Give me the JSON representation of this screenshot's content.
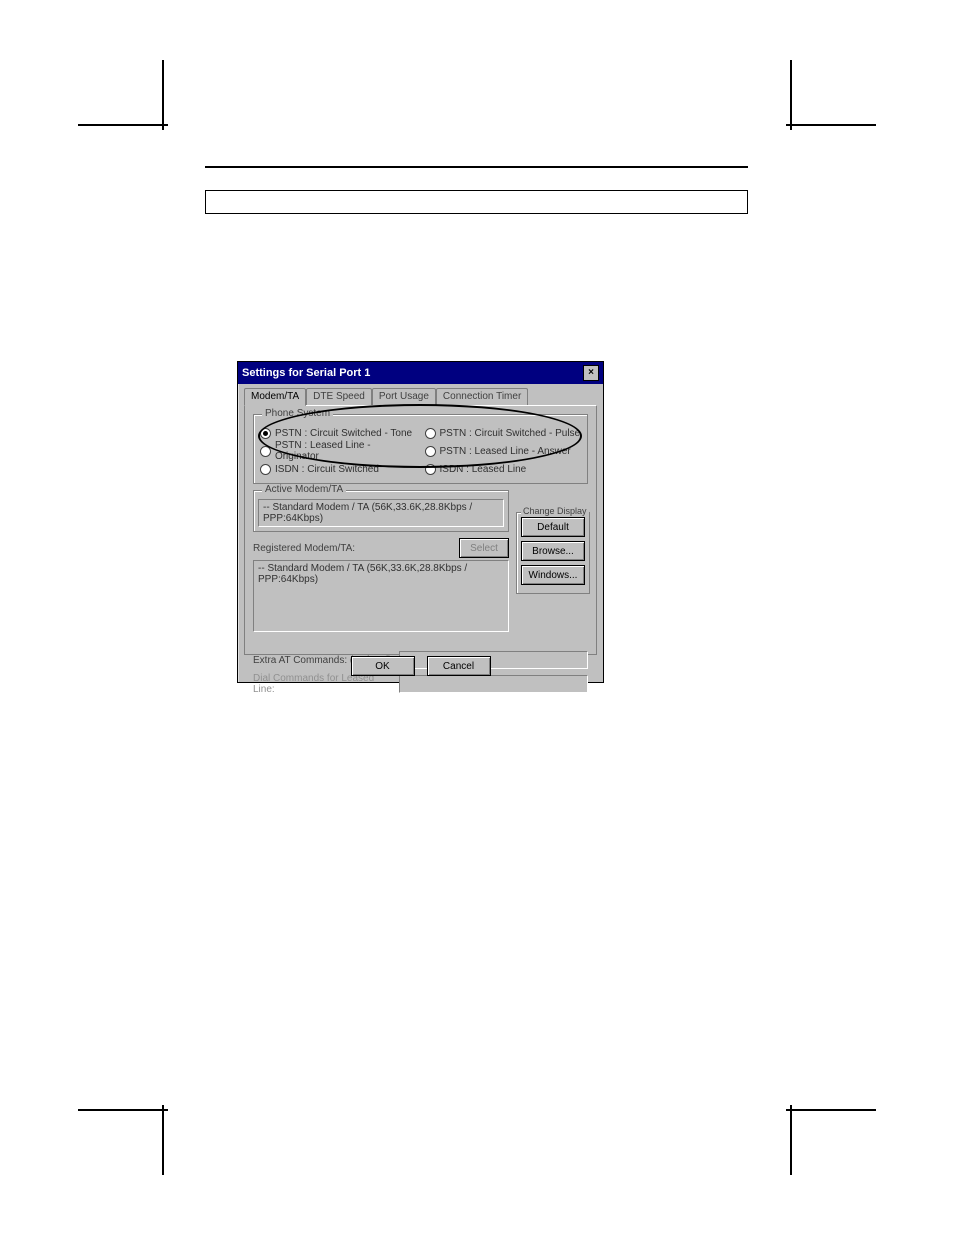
{
  "dialog": {
    "title": "Settings for Serial Port 1",
    "tabs": [
      "Modem/TA",
      "DTE Speed",
      "Port Usage",
      "Connection Timer"
    ],
    "active_tab": "Modem/TA",
    "phone_system": {
      "legend": "Phone System",
      "options": [
        "PSTN : Circuit Switched - Tone",
        "PSTN : Circuit Switched - Pulse",
        "PSTN : Leased Line - Originator",
        "PSTN : Leased Line - Answer",
        "ISDN : Circuit Switched",
        "ISDN : Leased Line"
      ],
      "selected_index": 0
    },
    "active_modem": {
      "legend": "Active Modem/TA",
      "value": "-- Standard Modem / TA (56K,33.6K,28.8Kbps / PPP:64Kbps)"
    },
    "registered": {
      "label": "Registered Modem/TA:",
      "select_label": "Select",
      "list_item": "-- Standard Modem / TA (56K,33.6K,28.8Kbps / PPP:64Kbps)"
    },
    "change_display": {
      "legend": "Change Display",
      "buttons": {
        "default": "Default",
        "browse": "Browse...",
        "windows": "Windows..."
      }
    },
    "extra_at": {
      "label": "Extra AT Commands: (optional)"
    },
    "dial_cmds": {
      "label": "Dial Commands for Leased Line:"
    },
    "ok": "OK",
    "cancel": "Cancel",
    "close_glyph": "×"
  }
}
